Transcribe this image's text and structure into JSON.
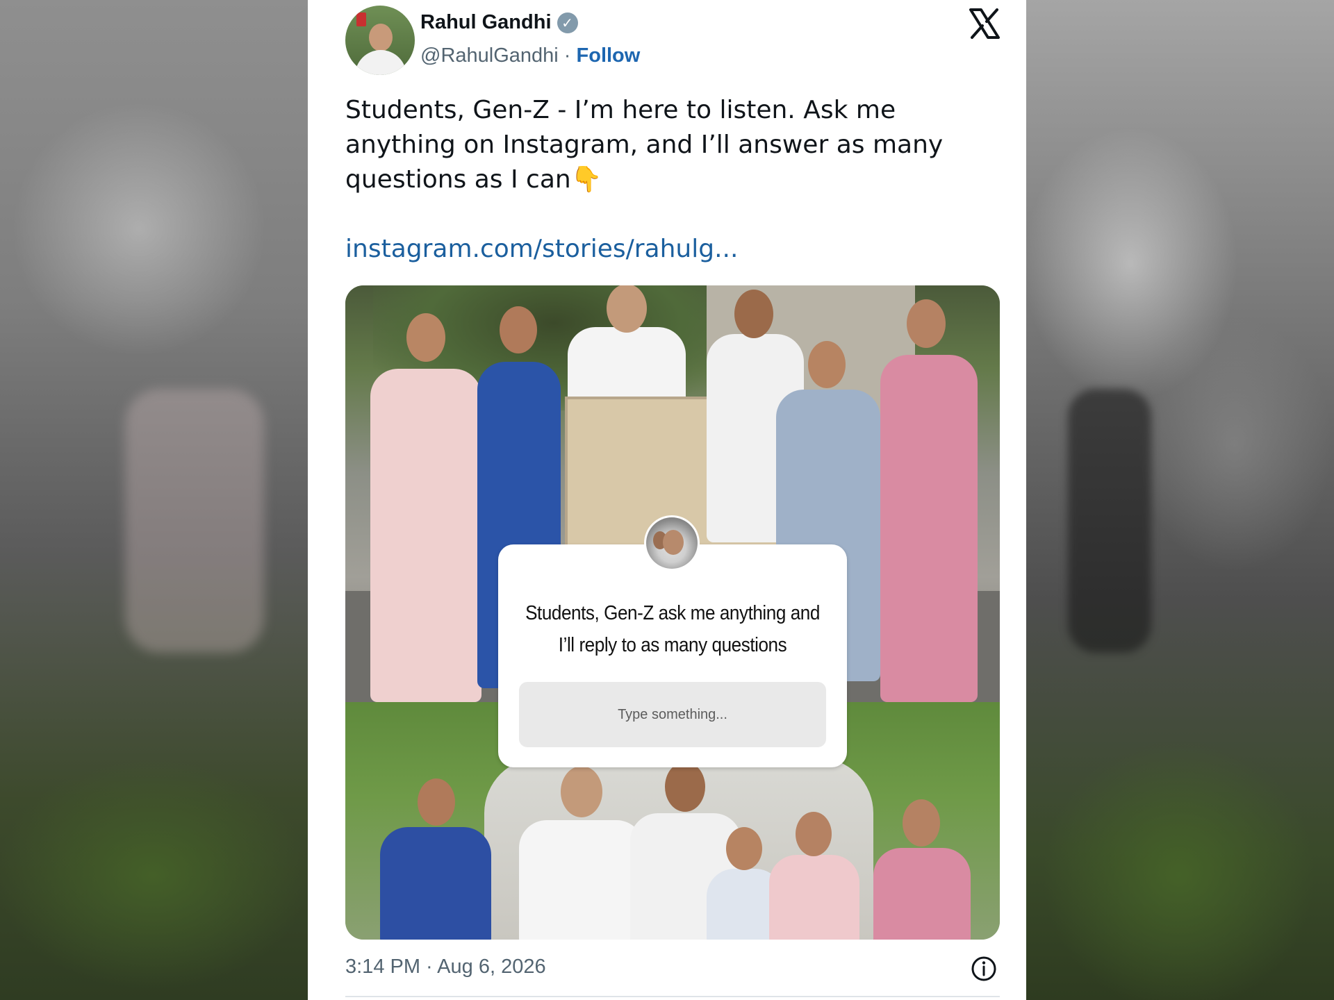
{
  "tweet": {
    "author_name": "Rahul Gandhi",
    "author_handle": "@RahulGandhi",
    "separator": " · ",
    "follow_label": "Follow",
    "verified_badge_icon": "verified-badge-icon",
    "platform_logo_icon": "x-logo-icon",
    "text": "Students, Gen-Z - I’m here to listen. Ask me anything on Instagram, and I’ll answer as many questions as I can👇",
    "link_text": "instagram.com/stories/rahulg...",
    "timestamp": "3:14 PM · Aug 6, 2026",
    "info_icon": "info-icon"
  },
  "story_overlay": {
    "question": "Students, Gen-Z ask me anything and I’ll reply to as many questions",
    "input_placeholder": "Type something..."
  },
  "colors": {
    "link_blue": "#1b5f9e",
    "follow_blue": "#1d66b0",
    "text_primary": "#0f1419",
    "text_secondary": "#536471",
    "verified_badge": "#829aab"
  }
}
